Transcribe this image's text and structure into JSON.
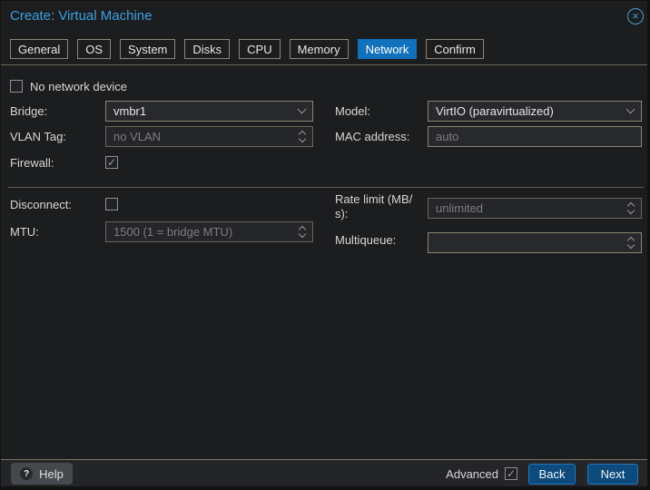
{
  "window": {
    "title": "Create: Virtual Machine"
  },
  "tabs": [
    {
      "label": "General",
      "active": false
    },
    {
      "label": "OS",
      "active": false
    },
    {
      "label": "System",
      "active": false
    },
    {
      "label": "Disks",
      "active": false
    },
    {
      "label": "CPU",
      "active": false
    },
    {
      "label": "Memory",
      "active": false
    },
    {
      "label": "Network",
      "active": true
    },
    {
      "label": "Confirm",
      "active": false
    }
  ],
  "form": {
    "no_network_device": {
      "label": "No network device",
      "checked": false
    },
    "bridge": {
      "label": "Bridge:",
      "value": "vmbr1"
    },
    "model": {
      "label": "Model:",
      "value": "VirtIO (paravirtualized)"
    },
    "vlan_tag": {
      "label": "VLAN Tag:",
      "placeholder": "no VLAN"
    },
    "mac_address": {
      "label": "MAC address:",
      "placeholder": "auto"
    },
    "firewall": {
      "label": "Firewall:",
      "checked": true
    },
    "disconnect": {
      "label": "Disconnect:",
      "checked": false
    },
    "rate_limit": {
      "label": "Rate limit (MB/s):",
      "placeholder": "unlimited"
    },
    "mtu": {
      "label": "MTU:",
      "placeholder": "1500 (1 = bridge MTU)"
    },
    "multiqueue": {
      "label": "Multiqueue:",
      "value": ""
    }
  },
  "footer": {
    "help_label": "Help",
    "advanced": {
      "label": "Advanced",
      "checked": true
    },
    "back_label": "Back",
    "next_label": "Next"
  },
  "colors": {
    "background": "#1c1d1f",
    "accent_blue": "#1271bc",
    "title_blue": "#3ba1e3",
    "close_icon_blue": "#4d9bd0",
    "field_border": "#8a8470",
    "disabled_field_border": "#67645a",
    "button_blue_bg": "#0e4b7c",
    "button_blue_border": "#2178bf"
  }
}
